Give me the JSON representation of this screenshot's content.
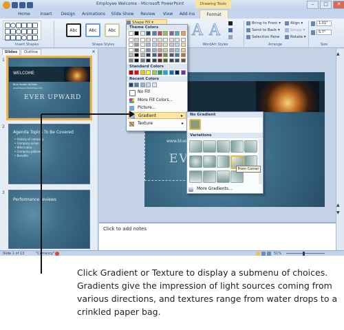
{
  "window": {
    "title": "Employee Welcome - Microsoft PowerPoint",
    "context_tab_label": "Drawing Tools",
    "controls": [
      "–",
      "□",
      "✕"
    ]
  },
  "ribbon": {
    "tabs": [
      "Home",
      "Insert",
      "Design",
      "Animations",
      "Slide Show",
      "Review",
      "View",
      "Add-Ins",
      "Format"
    ],
    "active_tab": "Format",
    "style_samples": [
      "Abc",
      "Abc",
      "Abc"
    ],
    "shape_fill_label": "Shape Fill ▾",
    "wordart_sample": "A",
    "arrange_items": [
      "Bring to Front ▾",
      "Send to Back ▾",
      "Selection Pane"
    ],
    "arrange_items2": [
      "Align ▾",
      "Group ▾",
      "Rotate ▾"
    ],
    "size_height": "1.01\"",
    "size_width": "5.7\"",
    "group_labels": [
      "Insert Shapes",
      "Shape Styles",
      "WordArt Styles",
      "Arrange",
      "Size"
    ]
  },
  "slides_pane": {
    "tabs": [
      "Slides",
      "Outline"
    ],
    "thumb1": {
      "num": "1",
      "title": "WELCOME",
      "line1": "Blue Yonder Airlines",
      "line2": "www.blueyonderairlines.com",
      "subtitle": "EVER UPWARD"
    },
    "thumb2": {
      "num": "2",
      "title": "Agenda Topics To Be Covered",
      "bullets": [
        "• History of company",
        "• Company vision",
        "• Who's who",
        "• Company policies",
        "• Benefits"
      ]
    },
    "thumb3": {
      "num": "3",
      "title": "Performance reviews"
    }
  },
  "slide": {
    "watermark_text": "www.blueyonderai",
    "big_text": "EVE"
  },
  "fill_menu": {
    "theme_header": "Theme Colors",
    "standard_header": "Standard Colors",
    "recent_header": "Recent Colors",
    "theme_colors": [
      "#ffffff",
      "#000000",
      "#eeece1",
      "#1f497d",
      "#4f81bd",
      "#c0504d",
      "#9bbb59",
      "#8064a2",
      "#4bacc6",
      "#f79646"
    ],
    "standard_colors": [
      "#c00000",
      "#ff0000",
      "#ffc000",
      "#ffff00",
      "#92d050",
      "#00b050",
      "#00b0f0",
      "#0070c0",
      "#002060",
      "#7030a0"
    ],
    "recent_colors": [
      "#1f497d",
      "#4f81bd",
      "#8db3e2",
      "#c6d9f0",
      "#dbe5f1"
    ],
    "items": [
      "No Fill",
      "More Fill Colors...",
      "Picture...",
      "Gradient",
      "Texture"
    ]
  },
  "gradient_menu": {
    "no_gradient_header": "No Gradient",
    "variations_header": "Variations",
    "more_label": "More Gradients...",
    "tooltip": "From Corner"
  },
  "notes": {
    "placeholder": "Click to add notes"
  },
  "statusbar": {
    "slide_info": "Slide 1 of 13",
    "theme": "\"Currency\"",
    "zoom": "51%"
  },
  "caption": {
    "text": "Click Gradient or Texture to display a submenu of choices. Gradients give the impression of light sources coming from various directions, and textures range from water drops to a crinkled paper bag."
  },
  "colors": {
    "accent_highlight": "#fde6a3",
    "selection_outline": "#f4b340"
  }
}
